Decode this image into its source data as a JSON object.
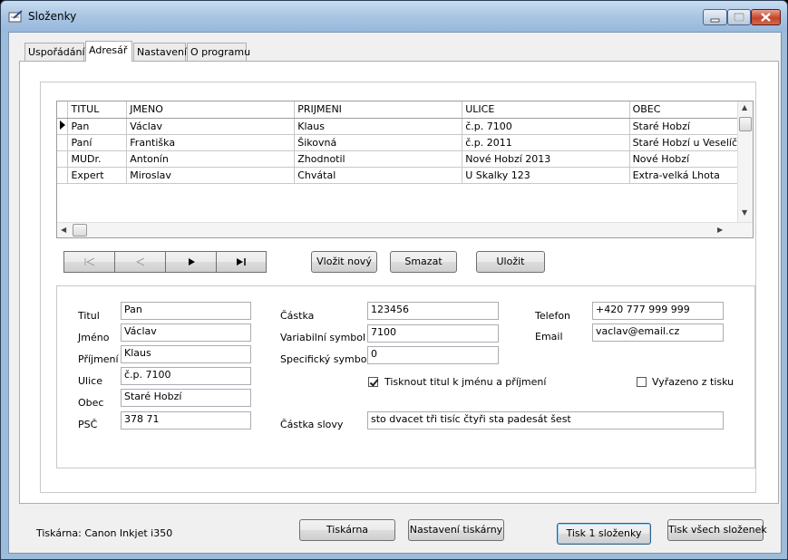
{
  "window": {
    "title": "Složenky"
  },
  "tabs": [
    "Uspořádání",
    "Adresář",
    "Nastavení",
    "O programu"
  ],
  "grid": {
    "columns": [
      "TITUL",
      "JMENO",
      "PRIJMENI",
      "ULICE",
      "OBEC"
    ],
    "rows": [
      [
        "Pan",
        "Václav",
        "Klaus",
        "č.p. 7100",
        "Staré Hobzí"
      ],
      [
        "Paní",
        "Františka",
        "Šikovná",
        "č.p. 2011",
        "Staré Hobzí u Veselíčka"
      ],
      [
        "MUDr.",
        "Antonín",
        "Zhodnotil",
        "Nové Hobzí 2013",
        "Nové Hobzí"
      ],
      [
        "Expert",
        "Miroslav",
        "Chvátal",
        "U Skalky 123",
        "Extra-velká Lhota"
      ]
    ]
  },
  "nav": {
    "first": "⏮",
    "prev": "◀",
    "next": "►",
    "last": "►|"
  },
  "actions": {
    "new": "Vložit nový",
    "delete": "Smazat",
    "save": "Uložit"
  },
  "form": {
    "labels": {
      "titul": "Titul",
      "jmeno": "Jméno",
      "prijmeni": "Příjmení",
      "ulice": "Ulice",
      "obec": "Obec",
      "psc": "PSČ",
      "castka": "Částka",
      "vs": "Variabilní symbol",
      "ss": "Specifický symbol",
      "telefon": "Telefon",
      "email": "Email",
      "castka_slovy": "Částka slovy"
    },
    "values": {
      "titul": "Pan",
      "jmeno": "Václav",
      "prijmeni": "Klaus",
      "ulice": "č.p. 7100",
      "obec": "Staré Hobzí",
      "psc": "378 71",
      "castka": "123456",
      "vs": "7100",
      "ss": "0",
      "telefon": "+420 777 999 999",
      "email": "vaclav@email.cz",
      "castka_slovy": "sto dvacet tři tisíc čtyři sta padesát šest"
    },
    "checks": {
      "print_title": "Tisknout titul k jménu a příjmení",
      "excluded": "Vyřazeno z tisku"
    }
  },
  "footer": {
    "printer": "Tiskárna: Canon Inkjet i350",
    "printer_button": "Tiskárna",
    "printer_settings": "Nastavení tiskárny",
    "print_one": "Tisk 1 složenky",
    "print_all": "Tisk všech složenek"
  }
}
